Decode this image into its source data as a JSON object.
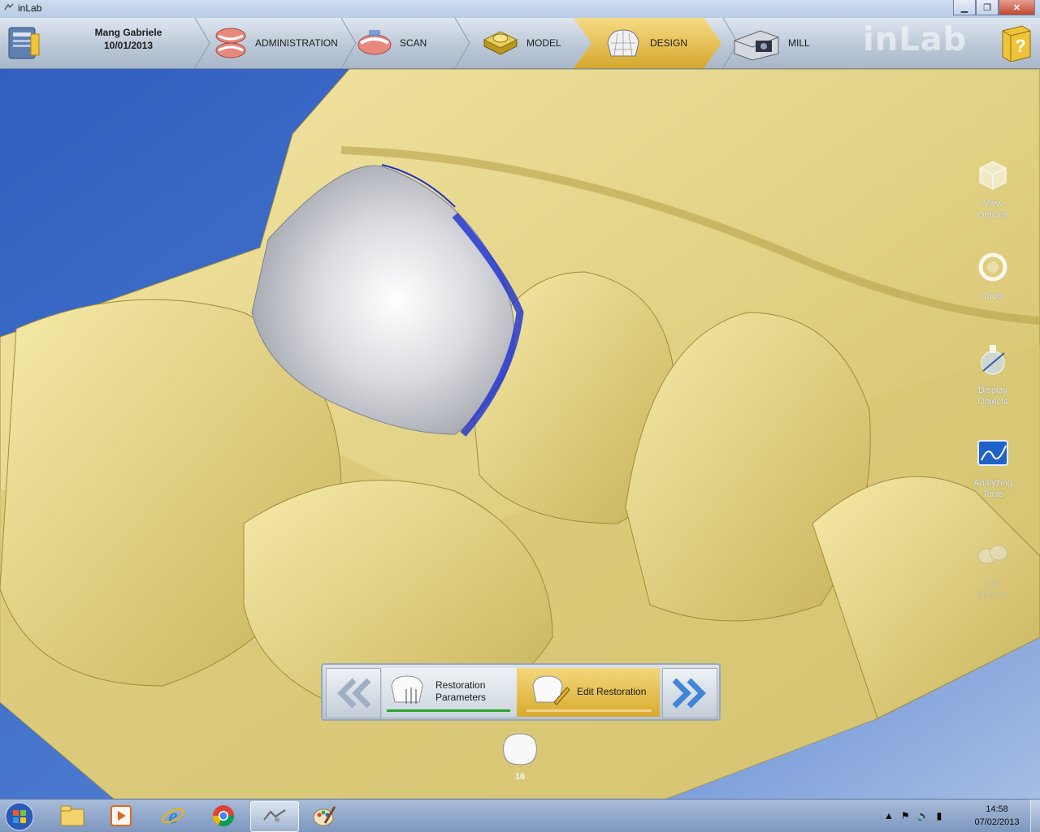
{
  "window": {
    "title": "inLab",
    "min_icon": "minimize-icon",
    "max_icon": "restore-icon",
    "close_icon": "close-icon"
  },
  "header": {
    "patient_name": "Mang Gabriele",
    "patient_date": "10/01/2013",
    "steps": [
      {
        "label": "ADMINISTRATION",
        "icon": "jaw-model-icon"
      },
      {
        "label": "SCAN",
        "icon": "scan-jaw-icon"
      },
      {
        "label": "MODEL",
        "icon": "model-icon"
      },
      {
        "label": "DESIGN",
        "icon": "crown-design-icon",
        "active": true
      },
      {
        "label": "MILL",
        "icon": "milling-machine-icon"
      }
    ],
    "brand": "inLab"
  },
  "side_tools": [
    {
      "label_line1": "View",
      "label_line2": "Options",
      "icon": "view-options-icon"
    },
    {
      "label_line1": "Tools",
      "label_line2": "",
      "icon": "tools-icon"
    },
    {
      "label_line1": "Display",
      "label_line2": "Objects",
      "icon": "display-objects-icon"
    },
    {
      "label_line1": "Analyzing",
      "label_line2": "Tools",
      "icon": "analyzing-tools-icon"
    },
    {
      "label_line1": "Link",
      "label_line2": "Options",
      "icon": "link-options-icon",
      "disabled": true
    }
  ],
  "phases": [
    {
      "label_line1": "Restoration",
      "label_line2": "Parameters",
      "progress_color": "#2aa52a"
    },
    {
      "label_line1": "Edit Restoration",
      "label_line2": "",
      "active": true
    }
  ],
  "tooth_number": "16",
  "taskbar": {
    "time": "14:58",
    "date": "07/02/2013",
    "apps": [
      "explorer-icon",
      "media-player-icon",
      "internet-explorer-icon",
      "chrome-icon",
      "inlab-app-icon",
      "paint-icon"
    ]
  },
  "colors": {
    "accent": "#e0b43a",
    "model": "#e9d98b",
    "background": "#3a66c4",
    "restoration": "#e2e4e8"
  }
}
